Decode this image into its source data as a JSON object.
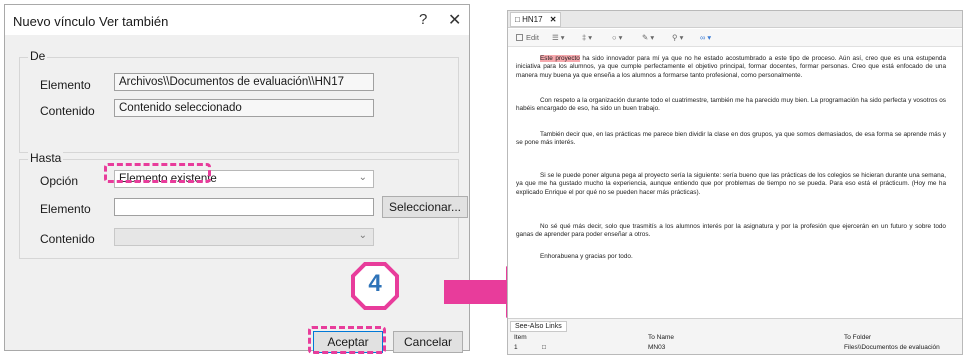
{
  "dialog": {
    "title": "Nuevo vínculo Ver también",
    "help_label": "?",
    "close_label": "✕",
    "de": {
      "label": "De",
      "elemento_label": "Elemento",
      "elemento_value": "Archivos\\\\Documentos de evaluación\\\\HN17",
      "contenido_label": "Contenido",
      "contenido_value": "Contenido seleccionado"
    },
    "hasta": {
      "label": "Hasta",
      "opcion_label": "Opción",
      "opcion_value": "Elemento existente",
      "elemento_label": "Elemento",
      "elemento_value": "",
      "select_button": "Seleccionar...",
      "contenido_label": "Contenido",
      "contenido_value": ""
    },
    "accept_button": "Aceptar",
    "cancel_button": "Cancelar"
  },
  "step_badge": "4",
  "colors": {
    "highlight": "#e83c9b",
    "badge_text": "#2e73b8",
    "primary_border": "#0078d7"
  },
  "editor": {
    "tab_label": "HN17",
    "tab_close": "✕",
    "toolbar": {
      "edit_label": "Edit",
      "icons": [
        "paragraph-icon",
        "text-size-icon",
        "shape-icon",
        "pen-icon",
        "zoom-icon",
        "link-icon"
      ]
    },
    "highlighted_phrase": "Este proyecto",
    "paragraphs": [
      " ha sido innovador para mí ya que no he estado acostumbrado a este tipo de proceso. Aún así, creo que es una estupenda iniciativa para los alumnos, ya que cumple perfectamente el objetivo principal, formar docentes, formar personas. Creo que está enfocado de una manera muy buena ya que enseña a los alumnos a formarse tanto profesional, como personalmente.",
      "Con respeto a la organización durante todo el cuatrimestre, también me ha parecido muy bien. La programación ha sido perfecta y vosotros os habéis encargado de eso, ha sido un buen trabajo.",
      "También decir que, en las prácticas me parece bien dividir la clase en dos grupos, ya que somos demasiados, de esa forma se aprende más y se pone más interés.",
      "Si se le puede poner alguna pega al proyecto sería la siguiente: sería bueno que las prácticas de los colegios se hicieran durante una semana, ya que me ha gustado mucho la experiencia, aunque entiendo que por problemas de tiempo no se pueda. Para eso está el prácticum. (Hoy me ha explicado Enrique el por qué no se pueden hacer más prácticas).",
      "No sé qué más decir, solo que trasmitís a los alumnos interés por la asignatura y por la profesión que ejercerán en un futuro y sobre todo ganas de aprender para poder enseñar a otros.",
      "Enhorabuena y gracias por todo."
    ],
    "see_also": {
      "tab_label": "See-Also Links",
      "headers": [
        "Item",
        "To Name",
        "To Folder"
      ],
      "rows": [
        {
          "item": "1",
          "to_name": "MN03",
          "to_folder": "Files\\\\Documentos de evaluación"
        }
      ]
    }
  }
}
